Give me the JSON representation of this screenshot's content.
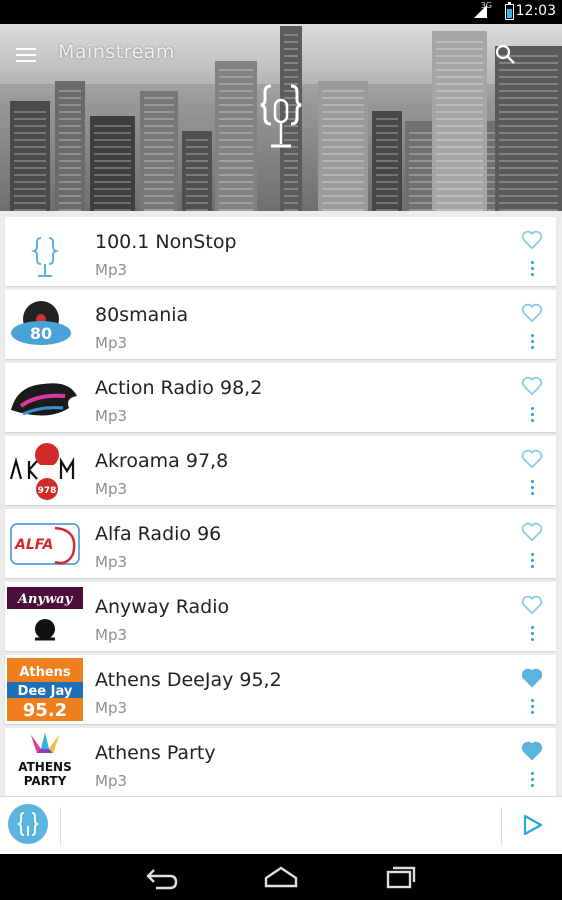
{
  "status_bar": {
    "network": "3G",
    "time": "12:03"
  },
  "header": {
    "title": "Mainstream"
  },
  "stations": [
    {
      "name": "100.1 NonStop",
      "format": "Mp3",
      "favorite": false,
      "logo": "app-mic-logo"
    },
    {
      "name": "80smania",
      "format": "Mp3",
      "favorite": false,
      "logo": "station-logo-80smania"
    },
    {
      "name": "Action Radio 98,2",
      "format": "Mp3",
      "favorite": false,
      "logo": "station-logo-action-radio"
    },
    {
      "name": "Akroama 97,8",
      "format": "Mp3",
      "favorite": false,
      "logo": "station-logo-akroama",
      "logo_text": "978"
    },
    {
      "name": "Alfa Radio 96",
      "format": "Mp3",
      "favorite": false,
      "logo": "station-logo-alfa",
      "logo_text": "ALFA"
    },
    {
      "name": "Anyway Radio",
      "format": "Mp3",
      "favorite": false,
      "logo": "station-logo-anyway",
      "logo_text": "Anyway"
    },
    {
      "name": "Athens DeeJay 95,2",
      "format": "Mp3",
      "favorite": true,
      "logo": "station-logo-athens-deejay",
      "logo_lines": [
        "Athens",
        "Dee Jay",
        "95.2"
      ]
    },
    {
      "name": "Athens Party",
      "format": "Mp3",
      "favorite": true,
      "logo": "station-logo-athens-party",
      "logo_lines": [
        "ATHENS",
        "PARTY"
      ]
    }
  ],
  "colors": {
    "accent": "#29a7dc",
    "accent_light": "#8ccdea",
    "background": "#ececec"
  },
  "icons": {
    "menu": "hamburger-icon",
    "search": "search-icon",
    "favorite": "heart-icon",
    "more": "overflow-dots-icon",
    "play": "play-icon",
    "back": "back-icon",
    "home": "home-icon",
    "recents": "recents-icon"
  }
}
